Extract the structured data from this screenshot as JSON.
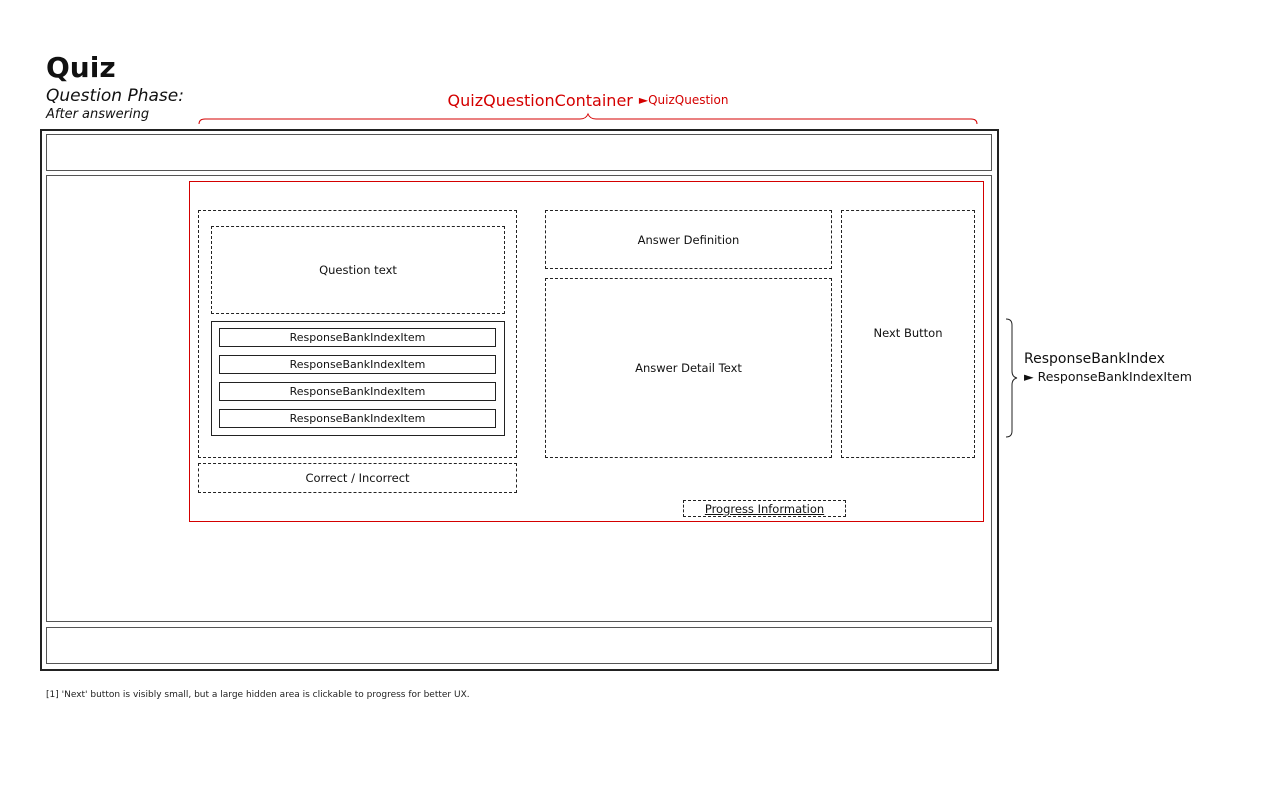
{
  "header": {
    "title": "Quiz",
    "phase": "Question Phase:",
    "phase_sub": "After answering"
  },
  "container": {
    "label": "QuizQuestionContainer",
    "sub_label": "►QuizQuestion"
  },
  "question": {
    "text_label": "Question text",
    "response_items": [
      "ResponseBankIndexItem",
      "ResponseBankIndexItem",
      "ResponseBankIndexItem",
      "ResponseBankIndexItem"
    ],
    "result_label": "Correct / Incorrect"
  },
  "answer": {
    "definition_label": "Answer Definition",
    "detail_label": "Answer Detail Text"
  },
  "next_button_label": "Next Button",
  "progress_label": "Progress Information",
  "side_annotation": {
    "label": "ResponseBankIndex",
    "sub_label": "► ResponseBankIndexItem"
  },
  "footnote": "[1] 'Next' button is visibly small, but a large hidden area is clickable to progress for better UX.",
  "colors": {
    "annotation_red": "#d40000",
    "outline": "#222222"
  }
}
